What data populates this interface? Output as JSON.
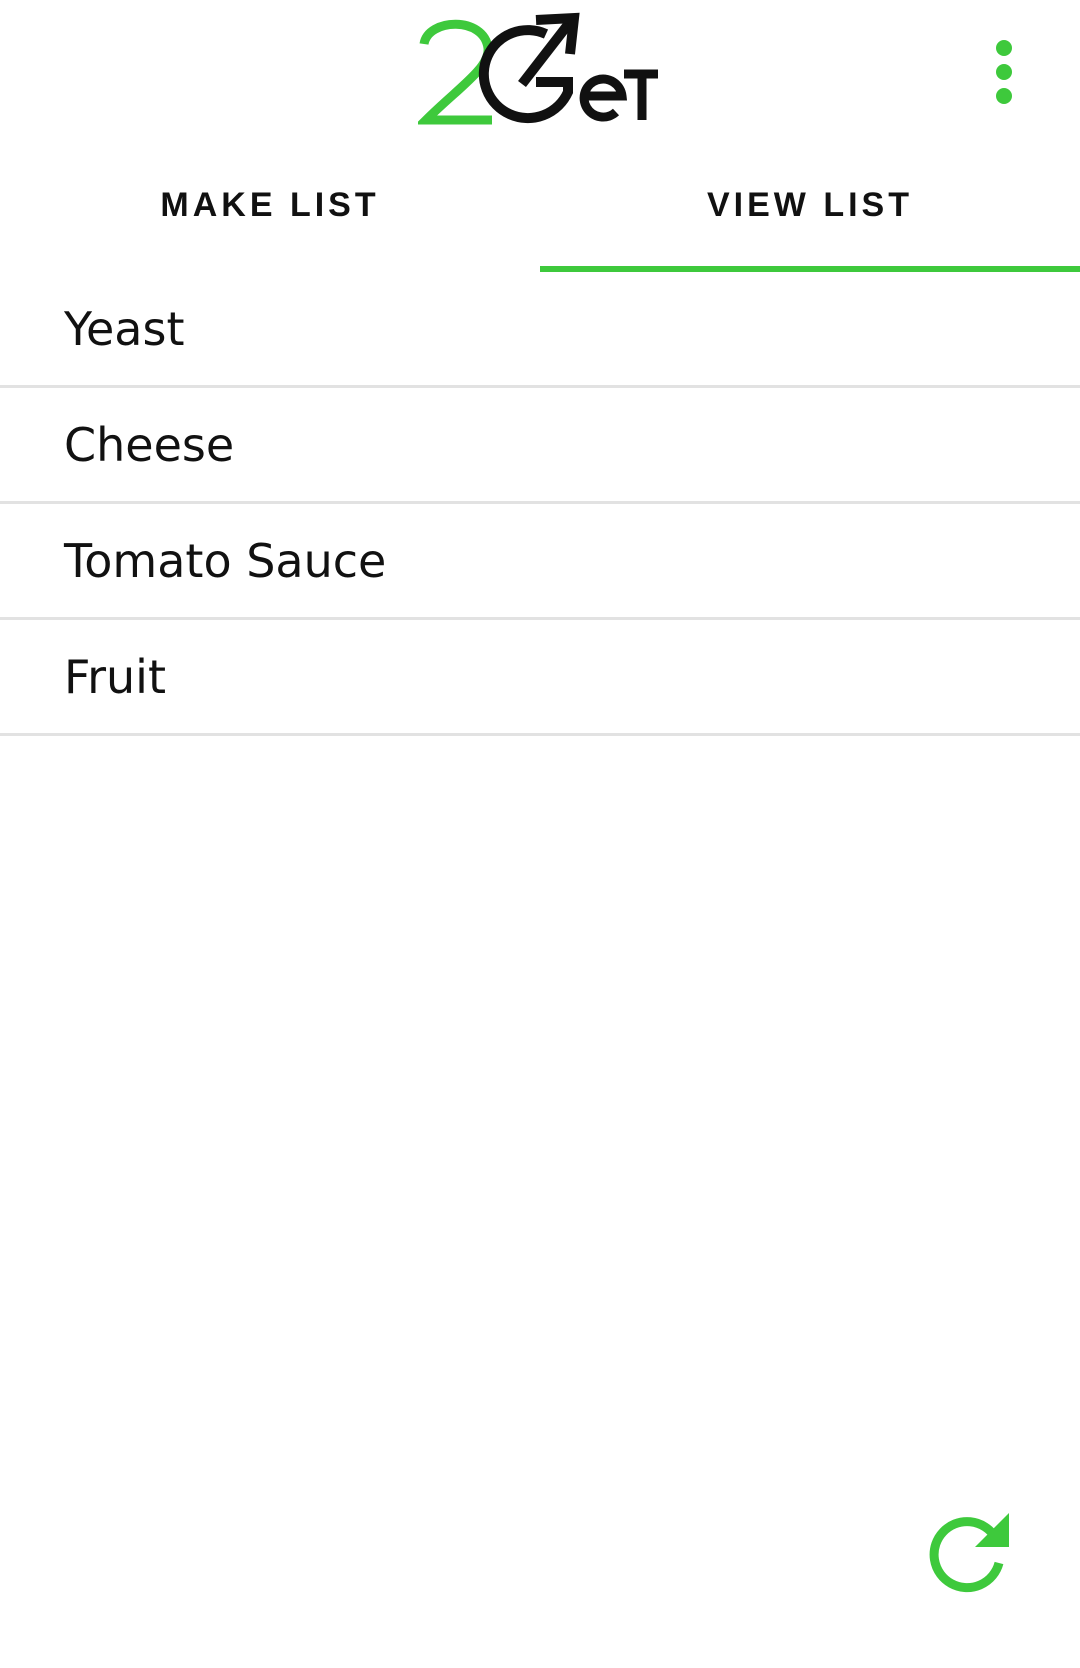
{
  "app": {
    "logo_text": "2GeT",
    "logo_icon": "arrow-up-right-icon"
  },
  "header": {
    "menu_icon": "more-vertical-icon"
  },
  "tabs": [
    {
      "label": "MAKE LIST",
      "selected": false
    },
    {
      "label": "VIEW LIST",
      "selected": true
    }
  ],
  "list": {
    "items": [
      {
        "label": "Yeast"
      },
      {
        "label": "Cheese"
      },
      {
        "label": "Tomato Sauce"
      },
      {
        "label": "Fruit"
      }
    ]
  },
  "actions": {
    "refresh_icon": "refresh-icon"
  },
  "colors": {
    "accent": "#3ec93c",
    "text": "#111111",
    "divider": "#e2e2e2",
    "background": "#ffffff"
  }
}
